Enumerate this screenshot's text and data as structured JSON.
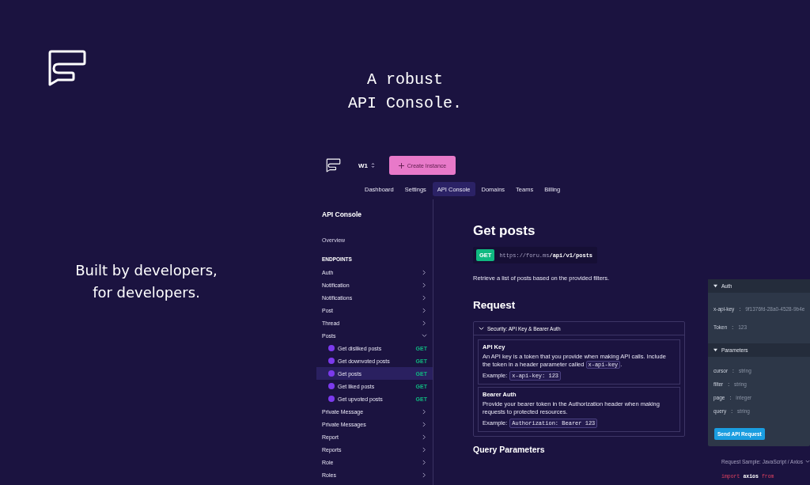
{
  "headline": [
    "A robust",
    "API Console."
  ],
  "tagline": [
    "Built by developers,",
    "for developers."
  ],
  "app": {
    "workspace": "W1",
    "create_button": "Create Instance",
    "nav": [
      {
        "label": "Dashboard",
        "selected": false
      },
      {
        "label": "Settings",
        "selected": false
      },
      {
        "label": "API Console",
        "selected": true
      },
      {
        "label": "Domains",
        "selected": false
      },
      {
        "label": "Teams",
        "selected": false
      },
      {
        "label": "Billing",
        "selected": false
      }
    ],
    "sidebar": {
      "title": "API Console",
      "overview": "Overview",
      "section": "ENDPOINTS",
      "items": [
        {
          "label": "Auth",
          "expanded": false
        },
        {
          "label": "Notification",
          "expanded": false
        },
        {
          "label": "Notifications",
          "expanded": false
        },
        {
          "label": "Post",
          "expanded": false
        },
        {
          "label": "Thread",
          "expanded": false
        },
        {
          "label": "Posts",
          "expanded": true,
          "children": [
            {
              "label": "Get disliked posts",
              "method": "GET",
              "selected": false,
              "color": "#7c3aed"
            },
            {
              "label": "Get downvoted posts",
              "method": "GET",
              "selected": false,
              "color": "#7c3aed"
            },
            {
              "label": "Get posts",
              "method": "GET",
              "selected": true,
              "color": "#7c3aed"
            },
            {
              "label": "Get liked posts",
              "method": "GET",
              "selected": false,
              "color": "#7c3aed"
            },
            {
              "label": "Get upvoted posts",
              "method": "GET",
              "selected": false,
              "color": "#7c3aed"
            }
          ]
        },
        {
          "label": "Private Message",
          "expanded": false
        },
        {
          "label": "Private Messages",
          "expanded": false
        },
        {
          "label": "Report",
          "expanded": false
        },
        {
          "label": "Reports",
          "expanded": false
        },
        {
          "label": "Role",
          "expanded": false
        },
        {
          "label": "Roles",
          "expanded": false
        }
      ]
    },
    "content": {
      "title": "Get posts",
      "method": "GET",
      "url": "https://foru.ms**/api/v1/posts**",
      "description": "Retrieve a list of posts based on the provided filters.",
      "request_heading": "Request",
      "security": {
        "title": "Security: API Key & Bearer Auth",
        "expanded": true,
        "schemes": [
          {
            "name": "API Key",
            "text_before": "An API key is a token that you provide when making API calls. Include the token in a header parameter called",
            "code": "x-api-key",
            "text_after": ".",
            "example_label": "Example:",
            "example": "x-api-key: 123"
          },
          {
            "name": "Bearer Auth",
            "text_before": "Provide your bearer token in the Authorization header when making requests to protected resources.",
            "example_label": "Example:",
            "example": "Authorization: Bearer 123"
          }
        ]
      },
      "query_heading": "Query Parameters"
    },
    "panel": {
      "sections": [
        {
          "title": "Auth",
          "expanded": true,
          "kind": "auth",
          "rows": [
            {
              "key": "x-api-key",
              "sep": ":",
              "value": "9f1376fd-28a0-4528-9b4e"
            },
            {
              "key": "Token",
              "sep": ":",
              "value": "123"
            }
          ]
        },
        {
          "title": "Parameters",
          "expanded": true,
          "kind": "params",
          "rows": [
            {
              "key": "cursor",
              "sep": ":",
              "value": "string"
            },
            {
              "key": "filter",
              "sep": ":",
              "value": "string"
            },
            {
              "key": "page",
              "sep": ":",
              "value": "integer"
            },
            {
              "key": "query",
              "sep": ":",
              "value": "string"
            }
          ]
        }
      ],
      "send_button": "Send API Request"
    },
    "sample": {
      "label": "Request Sample: JavaScript / Axios",
      "code": [
        {
          "text": "import",
          "kind": "keyword"
        },
        {
          "text": "axios",
          "kind": "name"
        },
        {
          "text": "from",
          "kind": "keyword"
        }
      ]
    }
  }
}
